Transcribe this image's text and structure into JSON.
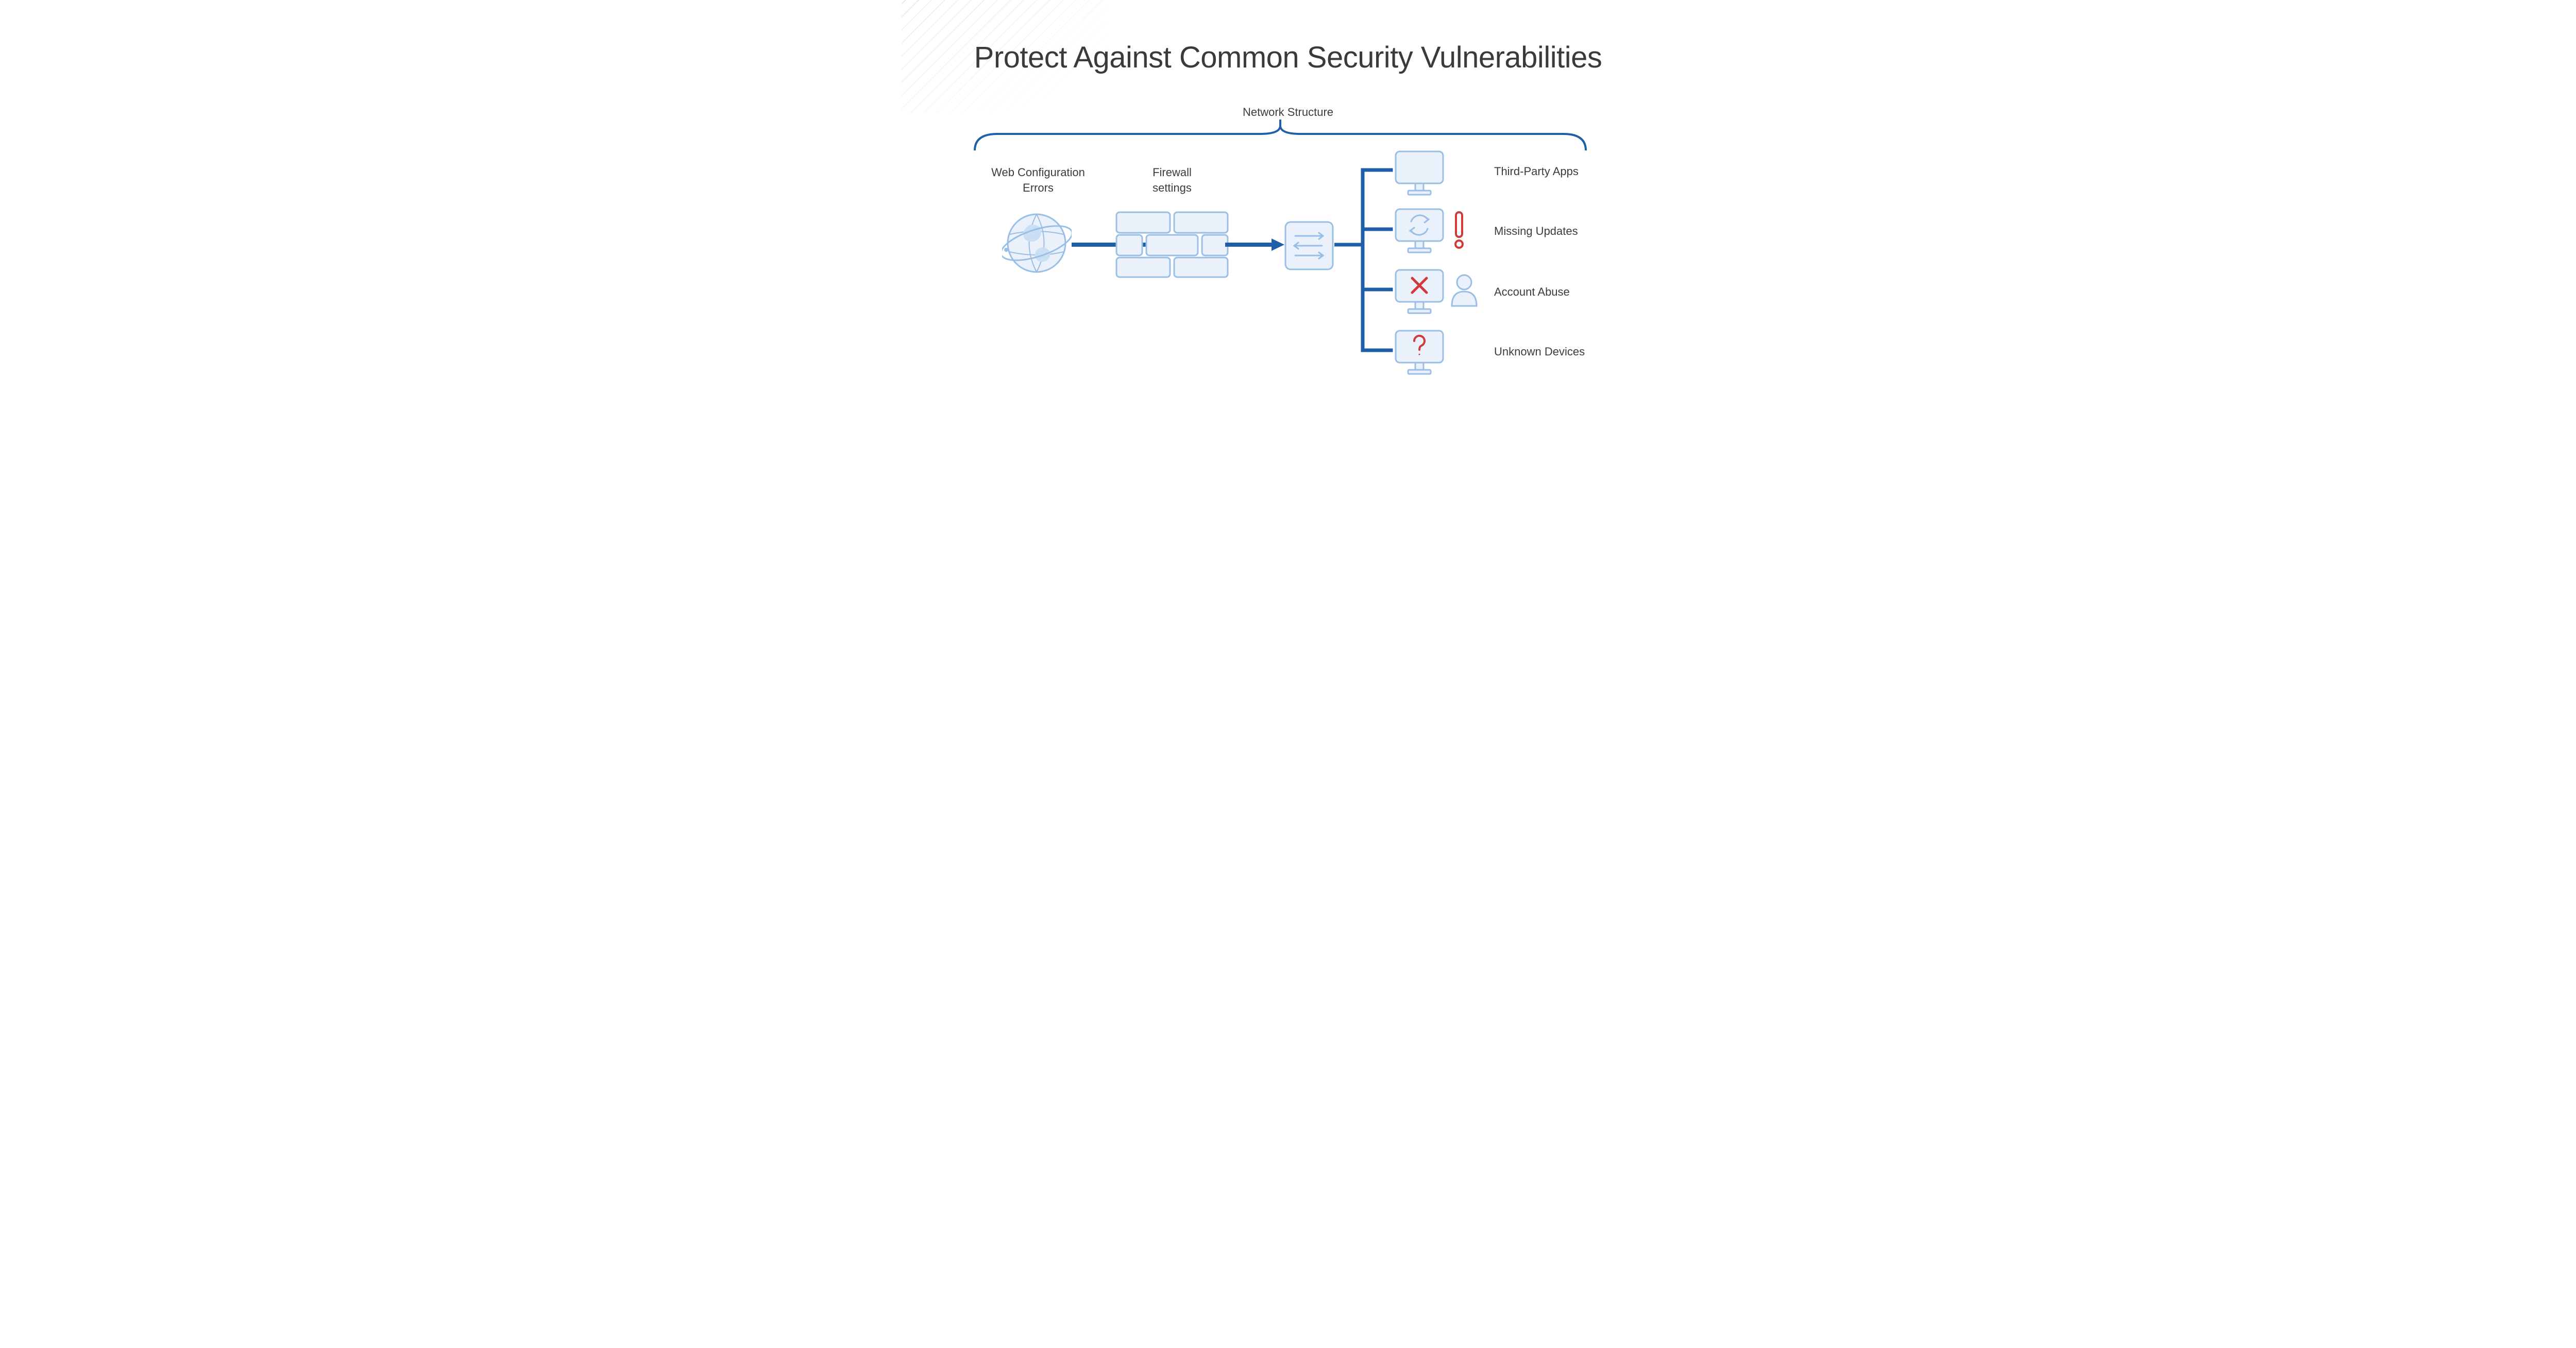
{
  "title": "Protect Against Common Security Vulnerabilities",
  "section_label": "Network Structure",
  "nodes": {
    "web": "Web Configuration\nErrors",
    "firewall": "Firewall\nsettings"
  },
  "endpoints": [
    {
      "label": "Third-Party Apps",
      "badge": null
    },
    {
      "label": "Missing Updates",
      "badge": "alert"
    },
    {
      "label": "Account Abuse",
      "badge": "user"
    },
    {
      "label": "Unknown Devices",
      "badge": null
    }
  ],
  "colors": {
    "stroke": "#1f5ea8",
    "stroke_light": "#9bbfe4",
    "fill_light": "#eaf1fb",
    "danger": "#d23a3a",
    "text": "#3c3c3c"
  }
}
